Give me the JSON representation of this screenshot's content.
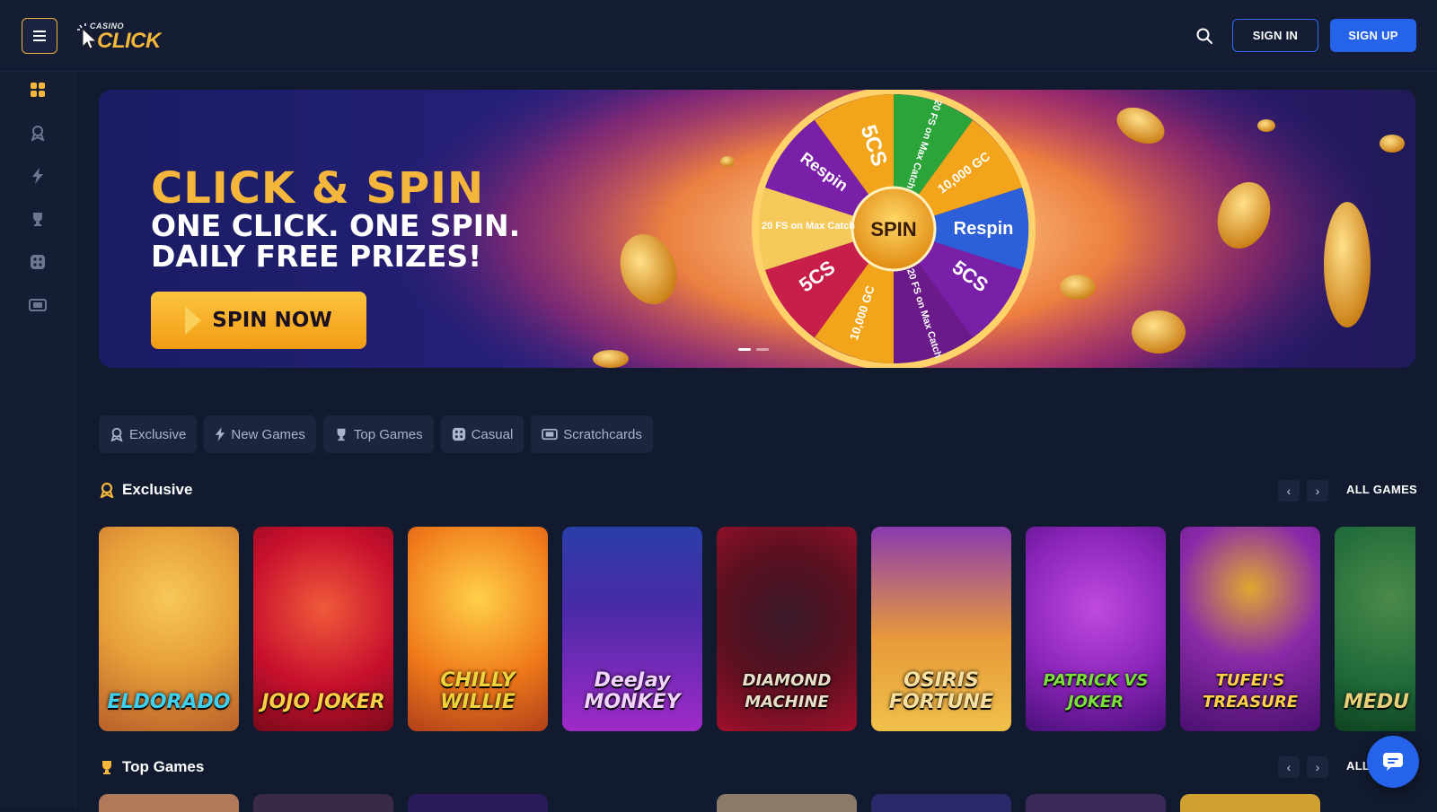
{
  "header": {
    "logo_small": "CASINO",
    "logo_main": "CLICK",
    "sign_in_label": "SIGN IN",
    "sign_up_label": "SIGN UP"
  },
  "sidebar": {
    "items": [
      {
        "icon": "grid-icon",
        "active": true
      },
      {
        "icon": "exclusive-icon",
        "active": false
      },
      {
        "icon": "lightning-icon",
        "active": false
      },
      {
        "icon": "trophy-icon",
        "active": false
      },
      {
        "icon": "dice-icon",
        "active": false
      },
      {
        "icon": "ticket-icon",
        "active": false
      }
    ]
  },
  "banner": {
    "title": "CLICK & SPIN",
    "subtitle_line1": "ONE CLICK. ONE SPIN.",
    "subtitle_line2": "DAILY FREE PRIZES!",
    "cta_label": "SPIN NOW",
    "wheel_center": "SPIN",
    "wheel_segments": [
      "5CS",
      "20 FS on Max Catch",
      "10,000 GC",
      "Respin",
      "5CS",
      "20 FS on Max Catch",
      "10,000 GC",
      "5CS",
      "20 FS on Max Catch",
      "Respin"
    ],
    "slides_total": 2,
    "active_slide": 1
  },
  "filters": [
    {
      "label": "Exclusive",
      "icon": "exclusive-icon"
    },
    {
      "label": "New Games",
      "icon": "lightning-icon"
    },
    {
      "label": "Top Games",
      "icon": "trophy-icon"
    },
    {
      "label": "Casual",
      "icon": "dice-icon"
    },
    {
      "label": "Scratchcards",
      "icon": "ticket-icon"
    }
  ],
  "sections": {
    "exclusive": {
      "title": "Exclusive",
      "all_label": "ALL GAMES",
      "games": [
        {
          "title": "ELDORADO",
          "bg": "#e8a13a"
        },
        {
          "title": "JOJO JOKER",
          "bg": "#c8102e"
        },
        {
          "title": "CHILLY WILLIE",
          "bg": "#f07b1a"
        },
        {
          "title": "DeeJay MONKEY",
          "bg": "#7a1fa8"
        },
        {
          "title": "DIAMOND MACHINE",
          "bg": "#7a1020"
        },
        {
          "title": "OSIRIS FORTUNE",
          "bg": "#d89a2a"
        },
        {
          "title": "PATRICK VS JOKER",
          "bg": "#8a24b8"
        },
        {
          "title": "TUFEI'S TREASURE",
          "bg": "#6a1a8a"
        },
        {
          "title": "MEDU FUR",
          "bg": "#1f6a3a"
        }
      ]
    },
    "top_games": {
      "title": "Top Games",
      "all_label": "ALL"
    }
  },
  "colors": {
    "accent_gold": "#f4b63b",
    "primary_blue": "#2563eb",
    "background": "#111a2e"
  }
}
